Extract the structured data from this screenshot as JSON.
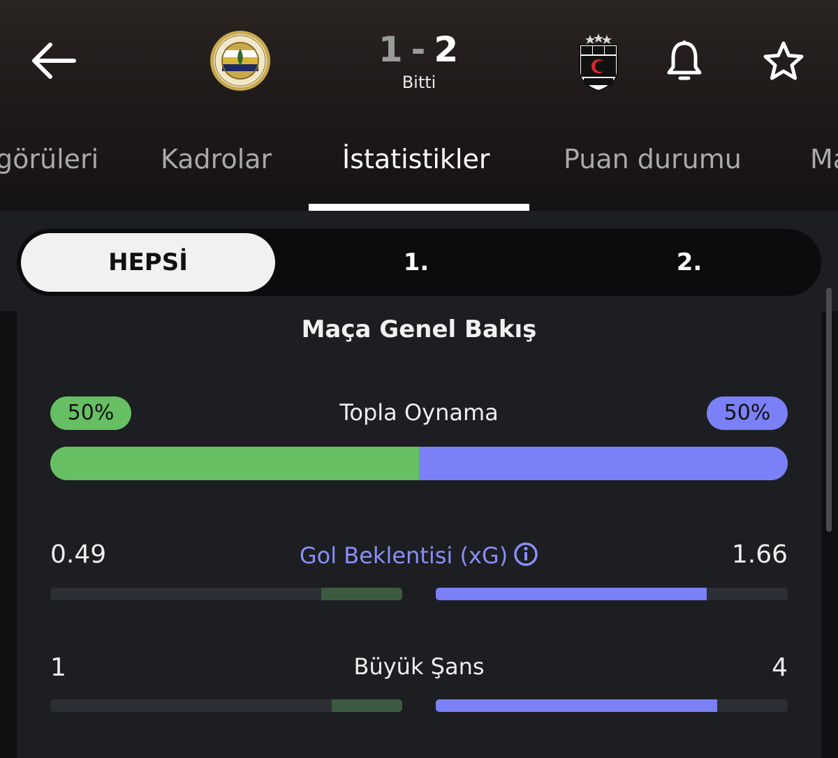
{
  "header": {
    "home_score": "1",
    "separator": "-",
    "away_score": "2",
    "status": "Bitti"
  },
  "tabs": [
    {
      "label": "görüleri"
    },
    {
      "label": "Kadrolar"
    },
    {
      "label": "İstatistikler",
      "active": true
    },
    {
      "label": "Puan durumu"
    },
    {
      "label": "Ma"
    }
  ],
  "period_filter": {
    "options": [
      "HEPSİ",
      "1.",
      "2."
    ],
    "selected": "HEPSİ"
  },
  "overview": {
    "title": "Maça Genel Bakış",
    "possession": {
      "label": "Topla Oynama",
      "home": "50%",
      "away": "50%",
      "home_share": 0.5,
      "away_share": 0.5
    },
    "expected_goals": {
      "label": "Gol Beklentisi (xG)",
      "home": "0.49",
      "away": "1.66",
      "home_share": 0.23,
      "away_share": 0.77
    },
    "big_chances": {
      "label": "Büyük Şans",
      "home": "1",
      "away": "4",
      "home_share": 0.2,
      "away_share": 0.8
    }
  },
  "colors": {
    "home": "#66bf62",
    "away": "#7b80f7",
    "home_dim": "#3c5a3f",
    "accent_label": "#8a8ff8"
  },
  "icons": {
    "back": "arrow-left-icon",
    "home_crest": "fenerbahce-crest-icon",
    "away_crest": "besiktas-crest-icon",
    "notify": "bell-icon",
    "favorite": "star-icon",
    "info": "info-icon"
  }
}
